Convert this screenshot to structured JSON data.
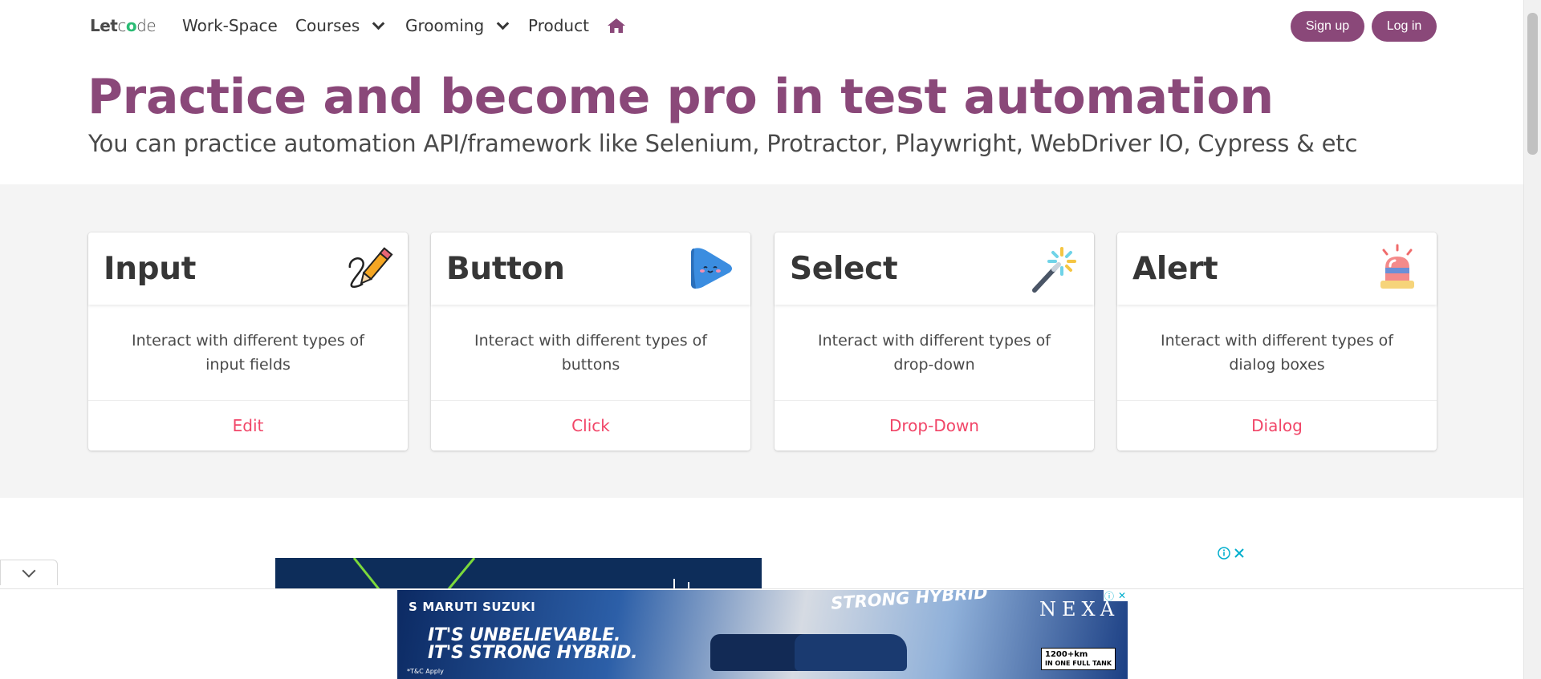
{
  "nav": {
    "brand_let": "Let",
    "brand_c": "c",
    "brand_o": "o",
    "brand_de": "de",
    "items": [
      {
        "label": "Work-Space"
      },
      {
        "label": "Courses"
      },
      {
        "label": "Grooming"
      },
      {
        "label": "Product"
      }
    ],
    "home_icon": "home-icon",
    "signup_label": "Sign up",
    "login_label": "Log in",
    "accent_color": "#8a4879"
  },
  "hero": {
    "title": "Practice and become pro in test automation",
    "subtitle": "You can practice automation API/framework like Selenium, Protractor, Playwright, WebDriver IO, Cypress & etc"
  },
  "cards": [
    {
      "title": "Input",
      "icon": "pencil-icon",
      "description": "Interact with different types of input fields",
      "action": "Edit"
    },
    {
      "title": "Button",
      "icon": "play-button-icon",
      "description": "Interact with different types of buttons",
      "action": "Click"
    },
    {
      "title": "Select",
      "icon": "magic-wand-icon",
      "description": "Interact with different types of drop-down",
      "action": "Drop-Down"
    },
    {
      "title": "Alert",
      "icon": "siren-icon",
      "description": "Interact with different types of dialog boxes",
      "action": "Dialog"
    }
  ],
  "ads": {
    "banner_brand": "MARUTI SUZUKI",
    "banner_line1": "IT'S UNBELIEVABLE.",
    "banner_line2": "IT'S STRONG HYBRID.",
    "banner_tag": "STRONG HYBRID",
    "banner_nexa": "NEXA",
    "banner_km_value": "1200+km",
    "banner_km_note": "IN ONE FULL TANK",
    "banner_tc": "*T&C Apply",
    "info_icon": "info-icon",
    "close_icon": "close-icon"
  }
}
